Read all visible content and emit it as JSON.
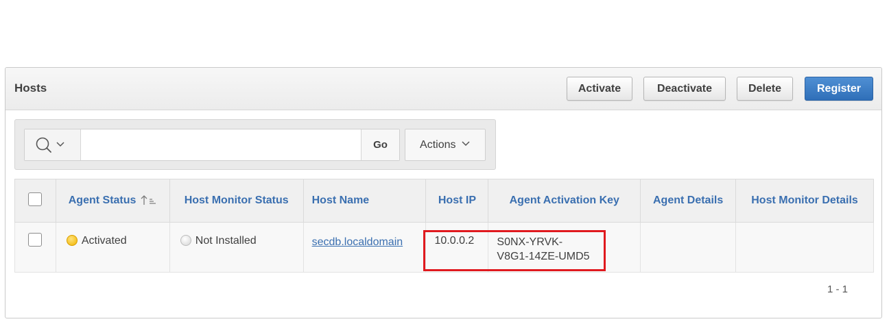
{
  "region": {
    "title": "Hosts",
    "buttons": {
      "activate": "Activate",
      "deactivate": "Deactivate",
      "delete": "Delete",
      "register": "Register"
    }
  },
  "toolbar": {
    "search_placeholder": "",
    "go_label": "Go",
    "actions_label": "Actions"
  },
  "table": {
    "columns": [
      "Agent Status",
      "Host Monitor Status",
      "Host Name",
      "Host IP",
      "Agent Activation Key",
      "Agent Details",
      "Host Monitor Details"
    ],
    "sort": {
      "column": "Agent Status",
      "direction": "ascending"
    },
    "rows": [
      {
        "agent_status": "Activated",
        "host_monitor_status": "Not Installed",
        "host_name": "secdb.localdomain",
        "host_ip": "10.0.0.2",
        "activation_key_line1": "S0NX-YRVK-",
        "activation_key_line2": "V8G1-14ZE-UMD5",
        "agent_details": "",
        "host_monitor_details": ""
      }
    ]
  },
  "pagination": {
    "range": "1 - 1"
  },
  "colors": {
    "link": "#3a6fb0",
    "primary_button": "#2f6fb8",
    "highlight": "#e0191e",
    "status_activated": "#f0b400",
    "status_not_installed": "#d4d4d4"
  },
  "icons": {
    "search": "search-icon",
    "dropdown": "chevron-down-icon",
    "sort": "sort-ascending-icon"
  }
}
